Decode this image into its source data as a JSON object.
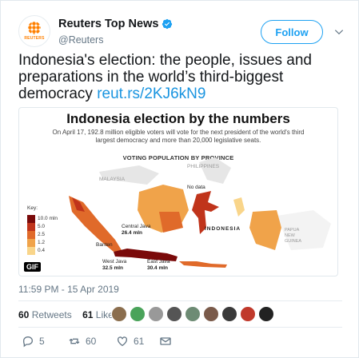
{
  "tweet": {
    "display_name": "Reuters Top News",
    "handle": "@Reuters",
    "avatar_brand": "REUTERS",
    "follow_label": "Follow",
    "text": "Indonesia's election: the people, issues and preparations in the world’s third-biggest democracy ",
    "link_text": "reut.rs/2KJ6kN9",
    "timestamp": "11:59 PM - 15 Apr 2019",
    "retweets_count": "60",
    "retweets_label": "Retweets",
    "likes_count": "61",
    "likes_label": "Likes",
    "reply_count": "5",
    "retweet_action_count": "60",
    "like_action_count": "61"
  },
  "media": {
    "title": "Indonesia election by the numbers",
    "subtitle": "On April 17, 192.8 million eligible voters will vote for the next president of the world's third largest democracy and more than 20,000 legislative seats.",
    "section_title": "VOTING POPULATION BY PROVINCE",
    "gif_badge": "GIF",
    "labels": {
      "philippines": "PHILIPPINES",
      "malaysia": "MALAYSIA",
      "no_data": "No data",
      "indonesia": "INDONESIA",
      "png": "PAPUA\nNEW\nGUINEA",
      "central_java": "Central Java",
      "central_java_val": "26.4 mln",
      "banten": "Banten",
      "west_java": "West Java",
      "west_java_val": "32.5 mln",
      "east_java": "East Java",
      "east_java_val": "30.4 mln"
    },
    "key": {
      "title": "Key:",
      "items": [
        "10.0 mln",
        "5.0",
        "2.5",
        "1.2",
        "0.4"
      ],
      "colors": [
        "#7a0a0a",
        "#c0341b",
        "#e06a2a",
        "#f0a34a",
        "#f9d58a"
      ]
    }
  },
  "colors": {
    "accent": "#1da1f2",
    "link": "#1b95e0",
    "muted": "#657786",
    "verified": "#1da1f2",
    "like_heart": "#e0245e"
  }
}
